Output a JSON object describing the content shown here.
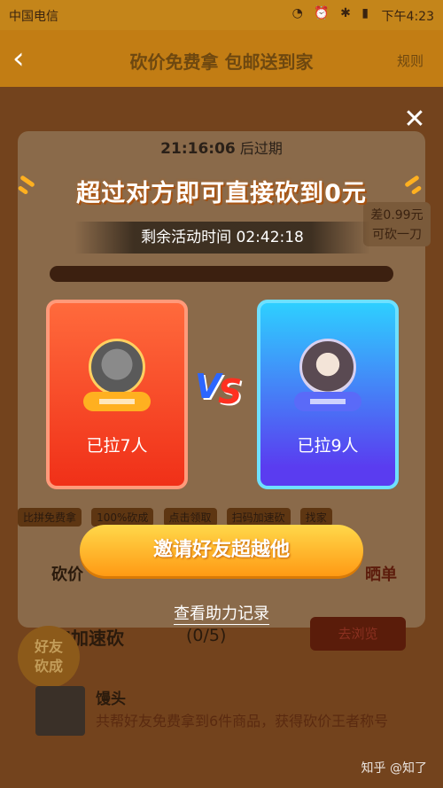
{
  "status_bar": {
    "carrier": "中国电信",
    "time": "下午4:23"
  },
  "nav": {
    "title": "砍价免费拿 包邮送到家",
    "right": "规则"
  },
  "background": {
    "expire_time": "21:16:06",
    "expire_suffix": "后过期",
    "diff_line1": "差0.99元",
    "diff_line2": "可砍一刀",
    "menu": [
      "比拼免费拿",
      "100%砍成",
      "点击领取",
      "扫码加速砍",
      "找家"
    ],
    "tab_left": "砍价",
    "tab_right": "晒单",
    "accel_title": "刀加速砍",
    "accel_count": "(0/5)",
    "accel_button": "去浏览",
    "float_badge_line1": "好友",
    "float_badge_line2": "砍成",
    "user_name": "馒头",
    "user_desc": "共帮好友免费拿到6件商品，获得砍价王者称号"
  },
  "modal": {
    "headline": "超过对方即可直接砍到0元",
    "remaining_label": "剩余活动时间",
    "remaining_time": "02:42:18",
    "left_count": "已拉7人",
    "right_count": "已拉9人",
    "vs_v": "V",
    "vs_s": "S",
    "invite_button": "邀请好友超越他",
    "record_link": "查看助力记录"
  },
  "watermark": "知乎 @知了"
}
